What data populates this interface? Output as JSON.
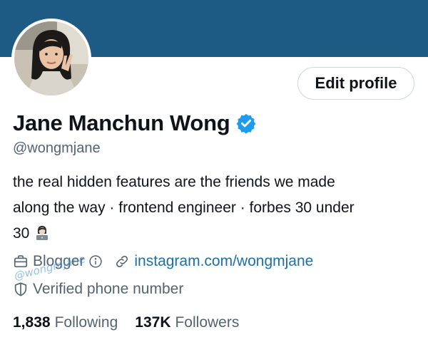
{
  "profile": {
    "display_name": "Jane Manchun Wong",
    "handle": "@wongmjane",
    "verified": true,
    "bio_line1": "the real hidden features are the friends we made",
    "bio_line2": "along the way · frontend engineer · forbes 30 under",
    "bio_line3": "30",
    "category": "Blogger",
    "link": "instagram.com/wongmjane",
    "verified_phone": "Verified phone number",
    "watermark": "@wongmjane"
  },
  "actions": {
    "edit_profile_label": "Edit profile"
  },
  "stats": {
    "following_count": "1,838",
    "following_label": "Following",
    "followers_count": "137K",
    "followers_label": "Followers"
  },
  "colors": {
    "banner": "#1d5b85",
    "verified_badge": "#1d9bf0",
    "link": "#1d6fa5",
    "secondary_text": "#536471"
  },
  "icons": {
    "category": "briefcase-icon",
    "info": "info-icon",
    "link": "link-icon",
    "phone": "shield-icon",
    "verified": "verified-badge-icon",
    "bio_emoji": "woman-technologist-emoji"
  }
}
